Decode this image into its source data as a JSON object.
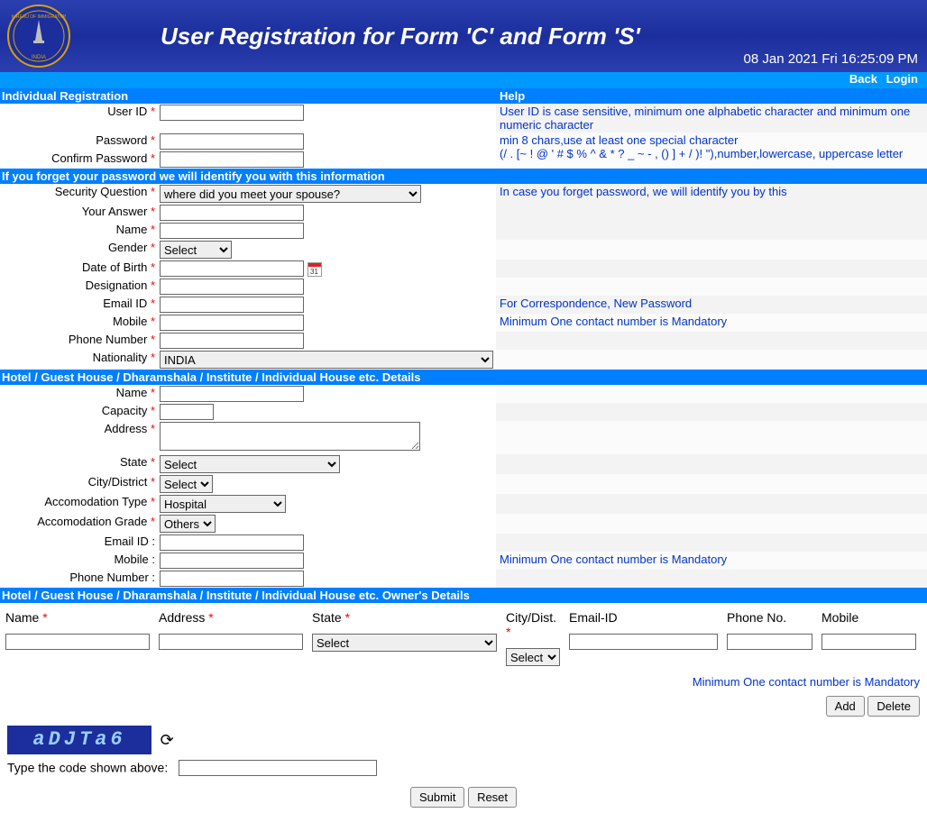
{
  "header": {
    "title": "User Registration for Form 'C' and Form 'S'",
    "timestamp": "08 Jan 2021 Fri 16:25:09 PM",
    "emblem_top": "BUREAU OF IMMIGRATION",
    "emblem_bottom": "INDIA"
  },
  "topnav": {
    "back": "Back",
    "login": "Login"
  },
  "sections": {
    "individual": "Individual Registration",
    "help": "Help",
    "forgot": "If you forget your password we will identify you with this information",
    "hotel": "Hotel / Guest House / Dharamshala / Institute / Individual House etc. Details",
    "owner": "Hotel / Guest House / Dharamshala / Institute / Individual House etc.  Owner's Details"
  },
  "labels": {
    "user_id": "User ID",
    "password": "Password",
    "confirm_password": "Confirm Password",
    "security_q": "Security Question",
    "your_answer": "Your Answer",
    "name": "Name",
    "gender": "Gender",
    "dob": "Date of Birth",
    "designation": "Designation",
    "email_id": "Email ID",
    "mobile": "Mobile",
    "phone_number": "Phone Number",
    "nationality": "Nationality",
    "capacity": "Capacity",
    "address": "Address",
    "state": "State",
    "city_district": "City/District",
    "accom_type": "Accomodation Type",
    "accom_grade": "Accomodation Grade",
    "email_id2": "Email ID :",
    "mobile2": "Mobile :",
    "phone2": "Phone Number :"
  },
  "help_text": {
    "user_id": "User ID is case sensitive, minimum one alphabetic character and minimum one numeric character",
    "password_l1": "min 8 chars,use at least one special character",
    "password_l2": "(/ . [~ ! @ ' # $ % ^ & * ? _ ~ - , () ] + / )! \"),number,lowercase, uppercase letter",
    "security": "  In case you forget password, we will identify you by this",
    "email": "For Correspondence, New Password",
    "mobile": "Minimum One contact number is Mandatory",
    "mobile2": "Minimum One contact number is Mandatory",
    "owner_mobile": "Minimum One contact number is Mandatory"
  },
  "select_values": {
    "security_q": "where did you meet your spouse?",
    "gender": "Select",
    "nationality": "INDIA",
    "state": "Select",
    "city": "Select",
    "accom_type": "Hospital",
    "accom_grade": "Others",
    "owner_state": "Select",
    "owner_city": "Select"
  },
  "owner_headers": {
    "name": "Name",
    "address": "Address",
    "state": "State",
    "city": "City/Dist.",
    "email": "Email-ID",
    "phone": "Phone No.",
    "mobile": "Mobile"
  },
  "buttons": {
    "add": "Add",
    "delete": "Delete",
    "submit": "Submit",
    "reset": "Reset"
  },
  "captcha": {
    "text": "aDJTa6",
    "label": "Type the code shown above:"
  }
}
